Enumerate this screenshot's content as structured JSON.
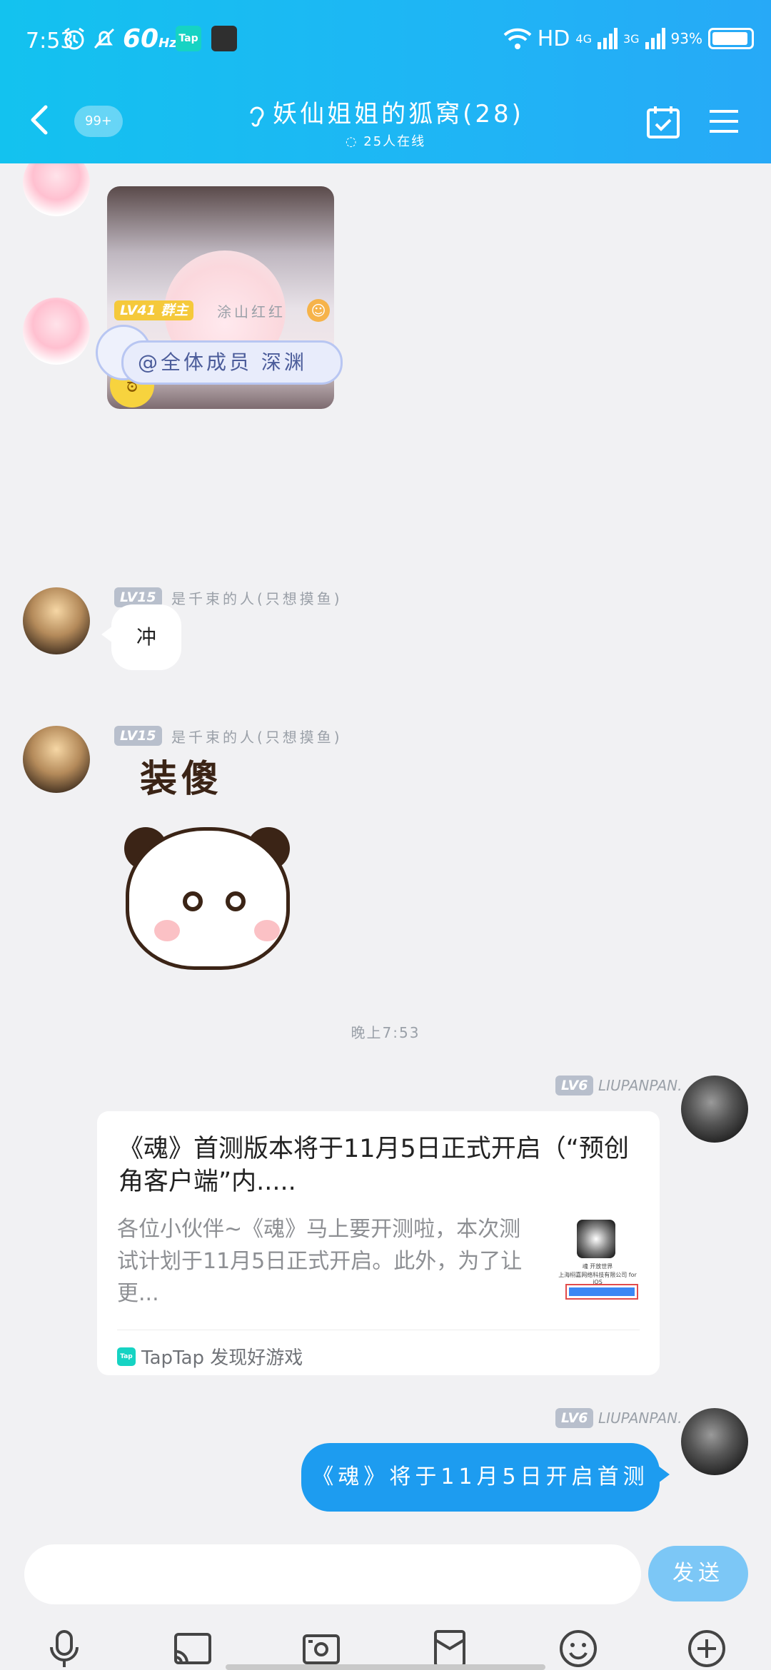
{
  "status_bar": {
    "time": "7:53",
    "refresh": "60",
    "refresh_unit": "Hz",
    "notif_app": "Tap",
    "network": "HD",
    "sim1": "4G",
    "sim2": "3G",
    "battery": "93%"
  },
  "header": {
    "unread_badge": "99+",
    "title": "妖仙姐姐的狐窝(28)",
    "online": "25人在线"
  },
  "messages": [
    {
      "sender": "",
      "level": "",
      "type": "sticker"
    },
    {
      "sender": "涂山红红",
      "level": "LV41",
      "role": "群主",
      "type": "at",
      "text": "@全体成员 深渊"
    },
    {
      "sender": "是千束的人(只想摸鱼)",
      "level": "LV15",
      "type": "text",
      "text": "冲"
    },
    {
      "sender": "是千束的人(只想摸鱼)",
      "level": "LV15",
      "type": "sticker",
      "sticker_text": "装傻"
    }
  ],
  "timestamp": "晚上7:53",
  "own_messages": [
    {
      "sender": "LIUPANPAN.",
      "level": "LV6",
      "card": {
        "title": "《魂》首测版本将于11月5日正式开启（“预创角客户端”内.....",
        "description": "各位小伙伴~《魂》马上要开测啦，本次测试计划于11月5日正式开启。此外，为了让更...",
        "thumb_line1": "魂 开放世界",
        "thumb_line2": "上海栩嘉网络科技有限公司 for iOS",
        "source": "TapTap 发现好游戏",
        "source_icon": "Tap"
      }
    },
    {
      "sender": "LIUPANPAN.",
      "level": "LV6",
      "text": "《魂》将于11月5日开启首测"
    }
  ],
  "input": {
    "placeholder": "",
    "send_label": "发送"
  },
  "colors": {
    "header": "#1fb5f5",
    "bubble_blue": "#1d9cf0",
    "send": "#7cc7f6"
  }
}
